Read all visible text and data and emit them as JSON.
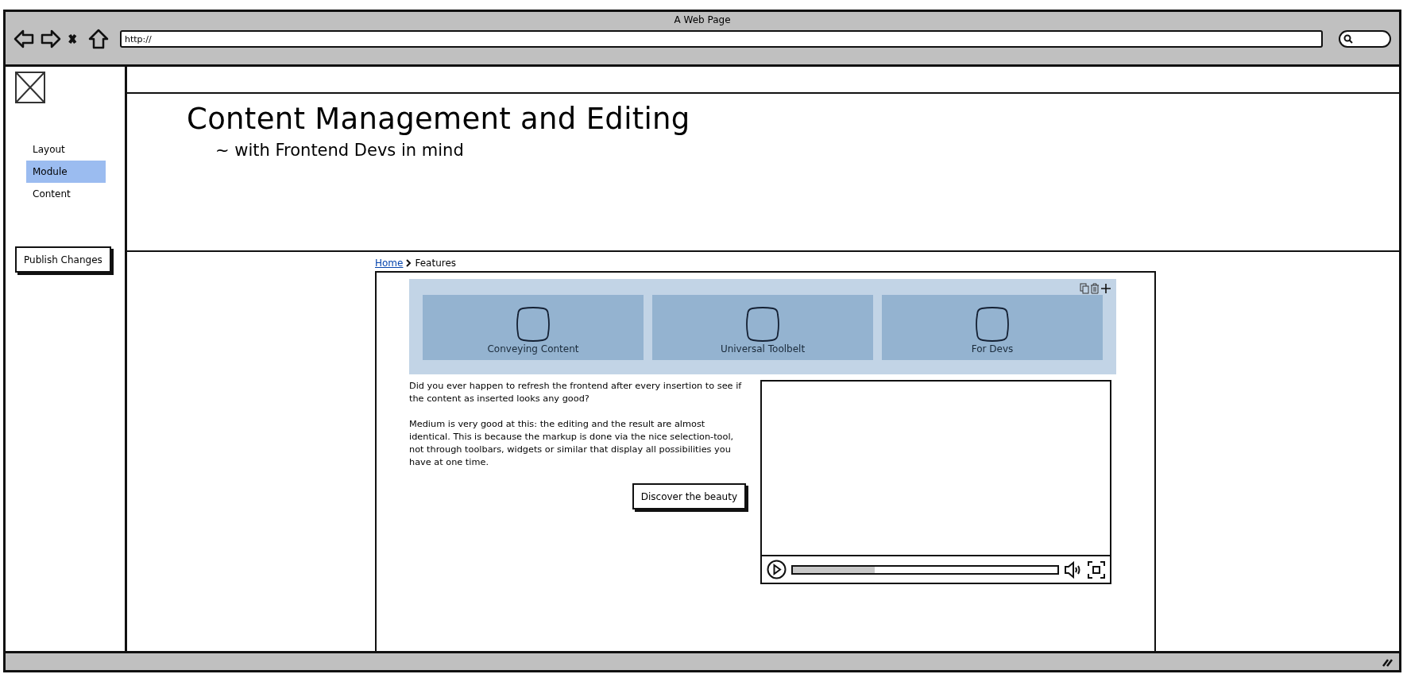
{
  "window": {
    "title": "A Web Page",
    "address": "http://"
  },
  "sidebar": {
    "items": [
      {
        "label": "Layout",
        "selected": false
      },
      {
        "label": "Module",
        "selected": true
      },
      {
        "label": "Content",
        "selected": false
      }
    ],
    "publish_button": "Publish Changes"
  },
  "header": {
    "title": "Content Management and Editing",
    "subtitle": "~ with Frontend Devs in mind"
  },
  "breadcrumb": [
    {
      "label": "Home",
      "kind": "link"
    },
    {
      "label": "Features",
      "kind": "current"
    }
  ],
  "module": {
    "cards": [
      {
        "label": "Conveying Content"
      },
      {
        "label": "Universal Toolbelt"
      },
      {
        "label": "For Devs"
      }
    ]
  },
  "article": {
    "paragraphs": [
      "Did you ever happen to refresh the frontend after every insertion to see if the content as inserted looks any good?",
      "Medium is very good at this: the editing and the result are almost identical. This is because the markup is done via the nice selection-tool, not through toolbars, widgets or similar that display all possibilities you have at one time."
    ],
    "button": "Discover the beauty"
  },
  "video": {
    "level": 0.31
  }
}
